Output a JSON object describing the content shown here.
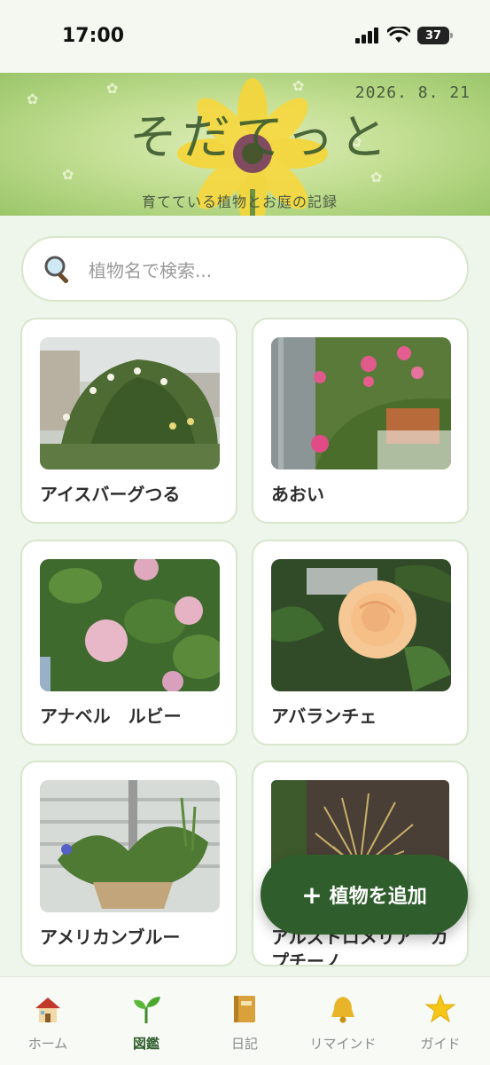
{
  "status_bar": {
    "time": "17:00",
    "battery": "37"
  },
  "banner": {
    "title": "そだてっと",
    "date": "2026. 8. 21",
    "subtitle": "育てている植物とお庭の記録"
  },
  "search": {
    "placeholder": "植物名で検索..."
  },
  "plants": [
    {
      "name": "アイスバーグつる"
    },
    {
      "name": "あおい"
    },
    {
      "name": "アナベル　ルビー"
    },
    {
      "name": "アバランチェ"
    },
    {
      "name": "アメリカンブルー"
    },
    {
      "name": "アルストロメリア　カプチーノ"
    }
  ],
  "add_button": {
    "label": "植物を追加"
  },
  "nav": [
    {
      "label": "ホーム",
      "icon": "house-icon"
    },
    {
      "label": "図鑑",
      "icon": "sprout-icon",
      "active": true
    },
    {
      "label": "日記",
      "icon": "notebook-icon"
    },
    {
      "label": "リマインド",
      "icon": "bell-icon"
    },
    {
      "label": "ガイド",
      "icon": "star-icon"
    }
  ],
  "colors": {
    "accent": "#2f5e2c",
    "background": "#eef5ea",
    "card_border": "#d7e6cc"
  }
}
